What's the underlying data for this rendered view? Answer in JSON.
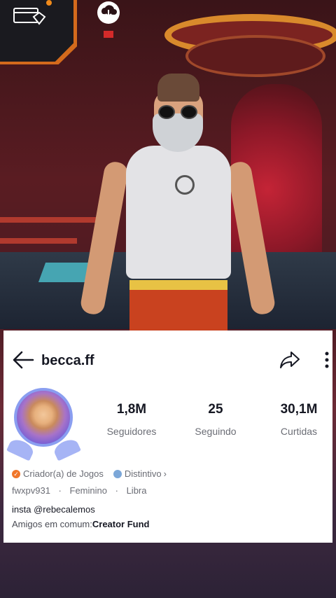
{
  "profile": {
    "username": "becca.ff",
    "stats": [
      {
        "value": "1,8M",
        "label": "Seguidores"
      },
      {
        "value": "25",
        "label": "Seguindo"
      },
      {
        "value": "30,1M",
        "label": "Curtidas"
      }
    ],
    "creator_badge": "Criador(a) de Jogos",
    "distinct_badge": "Distintivo",
    "distinct_chevron": "›",
    "meta": [
      "fwxpv931",
      "Feminino",
      "Libra"
    ],
    "meta_separator": "·",
    "bio_line1": "insta @rebecalemos",
    "mutual_prefix": "Amigos em comum:",
    "mutual_name": "Creator Fund"
  },
  "icons": {
    "back": "arrow-left-icon",
    "share": "share-icon",
    "more": "more-vertical-icon",
    "hud": "gem-card-icon",
    "download": "cloud-download-icon"
  },
  "colors": {
    "card_bg": "#ffffff",
    "text_primary": "#161823",
    "text_secondary": "#6b6d75",
    "creator_badge": "#f0762a",
    "hud_accent": "#d36a1c"
  }
}
